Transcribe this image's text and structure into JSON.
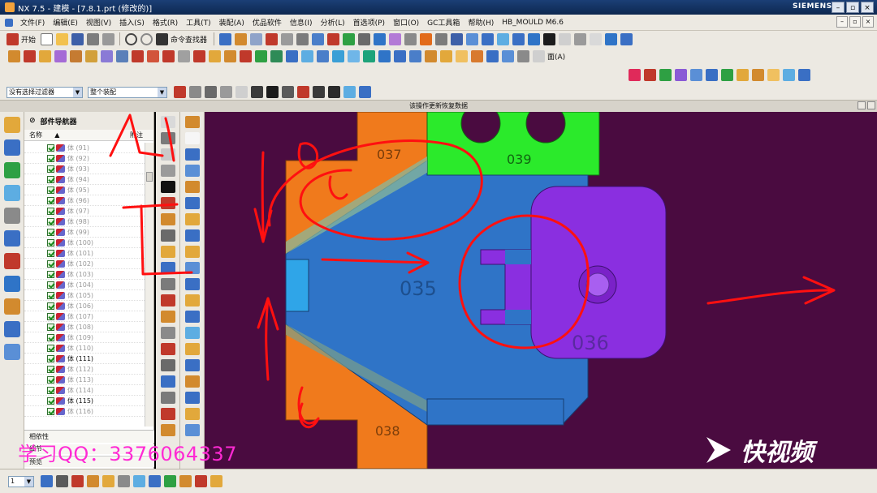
{
  "window": {
    "title": "NX 7.5 - 建模 - [7.8.1.prt  (修改的)]",
    "brand": "SIEMENS",
    "controls": [
      "–",
      "▫",
      "×"
    ]
  },
  "menu": [
    "文件(F)",
    "编辑(E)",
    "视图(V)",
    "插入(S)",
    "格式(R)",
    "工具(T)",
    "装配(A)",
    "优品软件",
    "信息(I)",
    "分析(L)",
    "首选项(P)",
    "窗口(O)",
    "GC工具箱",
    "帮助(H)",
    "HB_MOULD M6.6"
  ],
  "toolbar": {
    "start_label": "开始",
    "command_finder_label": "命令查找器",
    "face_label": "面(A)"
  },
  "filters": {
    "selection_filter": "没有选择过滤器",
    "assembly_scope": "整个装配"
  },
  "status": {
    "prompt": "该操作更新恢复数据"
  },
  "navigator": {
    "title": "部件导航器",
    "col_name": "名称",
    "col_extra": "附注",
    "rows": [
      {
        "label": "体 (91)",
        "dark": false
      },
      {
        "label": "体 (92)",
        "dark": false
      },
      {
        "label": "体 (93)",
        "dark": false
      },
      {
        "label": "体 (94)",
        "dark": false
      },
      {
        "label": "体 (95)",
        "dark": false
      },
      {
        "label": "体 (96)",
        "dark": false
      },
      {
        "label": "体 (97)",
        "dark": false
      },
      {
        "label": "体 (98)",
        "dark": false
      },
      {
        "label": "体 (99)",
        "dark": false
      },
      {
        "label": "体 (100)",
        "dark": false
      },
      {
        "label": "体 (101)",
        "dark": false
      },
      {
        "label": "体 (102)",
        "dark": false
      },
      {
        "label": "体 (103)",
        "dark": false
      },
      {
        "label": "体 (104)",
        "dark": false
      },
      {
        "label": "体 (105)",
        "dark": false
      },
      {
        "label": "体 (106)",
        "dark": false
      },
      {
        "label": "体 (107)",
        "dark": false
      },
      {
        "label": "体 (108)",
        "dark": false
      },
      {
        "label": "体 (109)",
        "dark": false
      },
      {
        "label": "体 (110)",
        "dark": false
      },
      {
        "label": "体 (111)",
        "dark": true
      },
      {
        "label": "体 (112)",
        "dark": false
      },
      {
        "label": "体 (113)",
        "dark": false
      },
      {
        "label": "体 (114)",
        "dark": false
      },
      {
        "label": "体 (115)",
        "dark": true
      },
      {
        "label": "体 (116)",
        "dark": false
      }
    ],
    "dependency_label": "相依性",
    "detail_label": "细节",
    "preview_label": "预览"
  },
  "viewport": {
    "parts": {
      "p037": "037",
      "p039": "039",
      "p035": "035",
      "p036": "036",
      "p038": "038"
    },
    "colors": {
      "background": "#4a0b40",
      "orange": "#f07a1c",
      "green": "#2bea2b",
      "blue": "#2f74c7",
      "purple": "#8a2fe0",
      "annotation": "#ff1010"
    }
  },
  "bottom": {
    "layer_value": "1"
  },
  "watermark": {
    "qq": "学习QQ：3376064337",
    "logo_text": "快视频"
  }
}
